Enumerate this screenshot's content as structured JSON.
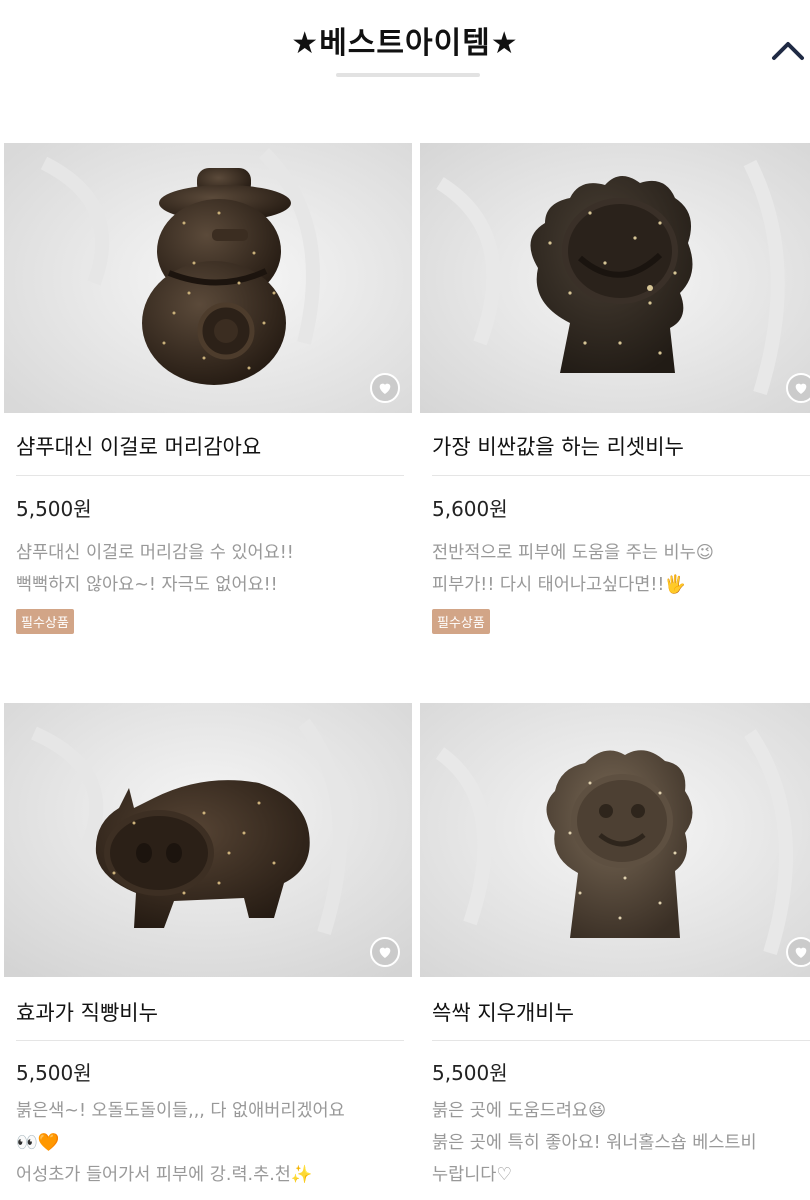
{
  "section": {
    "title": "★베스트아이템★"
  },
  "icons": {
    "collapse": "chevron-up-icon",
    "wishlist": "heart-icon"
  },
  "colors": {
    "badge": "#d2a587",
    "price": "#222222",
    "description": "#999999"
  },
  "products": [
    {
      "name": "샴푸대신 이걸로 머리감아요",
      "price": "5,500원",
      "description": [
        "샴푸대신 이걸로 머리감을 수 있어요!!",
        "뻑뻑하지 않아요~! 자극도 없어요!!"
      ],
      "badge": "필수상품",
      "image": "snowman-shaped-soap"
    },
    {
      "name": "가장 비싼값을 하는 리셋비누",
      "price": "5,600원",
      "description": [
        "전반적으로 피부에 도움을 주는 비누😉",
        "피부가!! 다시 태어나고싶다면!!🖐"
      ],
      "badge": "필수상품",
      "image": "lion-shaped-soap"
    },
    {
      "name": "효과가 직빵비누",
      "price": "5,500원",
      "description": [
        "붉은색~! 오돌도돌이들,,, 다 없애버리겠어요",
        "👀🧡",
        "어성초가 들어가서 피부에 강.력.추.천✨"
      ],
      "badge": "",
      "image": "pig-shaped-soap"
    },
    {
      "name": "쓱싹 지우개비누",
      "price": "5,500원",
      "description": [
        "붉은 곳에 도움드려요😆",
        "붉은 곳에 특히 좋아요! 워너홀스숍 베스트비",
        "누랍니다♡"
      ],
      "badge": "",
      "image": "lion-face-soap"
    }
  ]
}
